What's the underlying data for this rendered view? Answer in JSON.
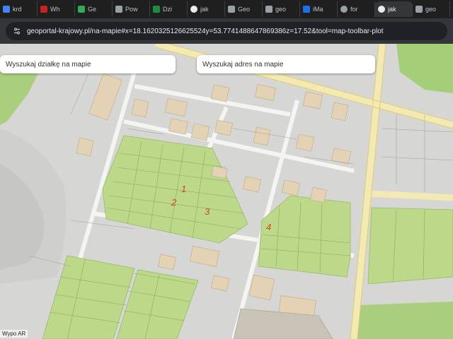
{
  "browser": {
    "tabs": [
      {
        "label": "krd",
        "fav_color": "#4285f4"
      },
      {
        "label": "Wh",
        "fav_color": "#c5221f"
      },
      {
        "label": "Ge",
        "fav_color": "#34a853"
      },
      {
        "label": "Pow",
        "fav_color": "#9aa0a6"
      },
      {
        "label": "Dzi",
        "fav_color": "#1e8e3e"
      },
      {
        "label": "jak",
        "fav_color": "#e8eaed"
      },
      {
        "label": "Geo",
        "fav_color": "#9aa0a6"
      },
      {
        "label": "geo",
        "fav_color": "#9aa0a6"
      },
      {
        "label": "iMa",
        "fav_color": "#1a73e8"
      },
      {
        "label": "for",
        "fav_color": "#9aa0a6"
      },
      {
        "label": "jak",
        "fav_color": "#e8eaed"
      },
      {
        "label": "geo",
        "fav_color": "#9aa0a6"
      }
    ],
    "url": "geoportal-krajowy.pl/na-mapie#x=18.1620325126625524y=53.7741488647869386z=17.52&tool=map-toolbar-plot"
  },
  "map": {
    "search_parcel_placeholder": "Wyszukaj działkę na mapie",
    "search_address_placeholder": "Wyszukaj adres na mapie",
    "attribution": "Wypo AR",
    "markers": [
      {
        "text": "1"
      },
      {
        "text": "2"
      },
      {
        "text": "3"
      },
      {
        "text": "4"
      }
    ]
  }
}
